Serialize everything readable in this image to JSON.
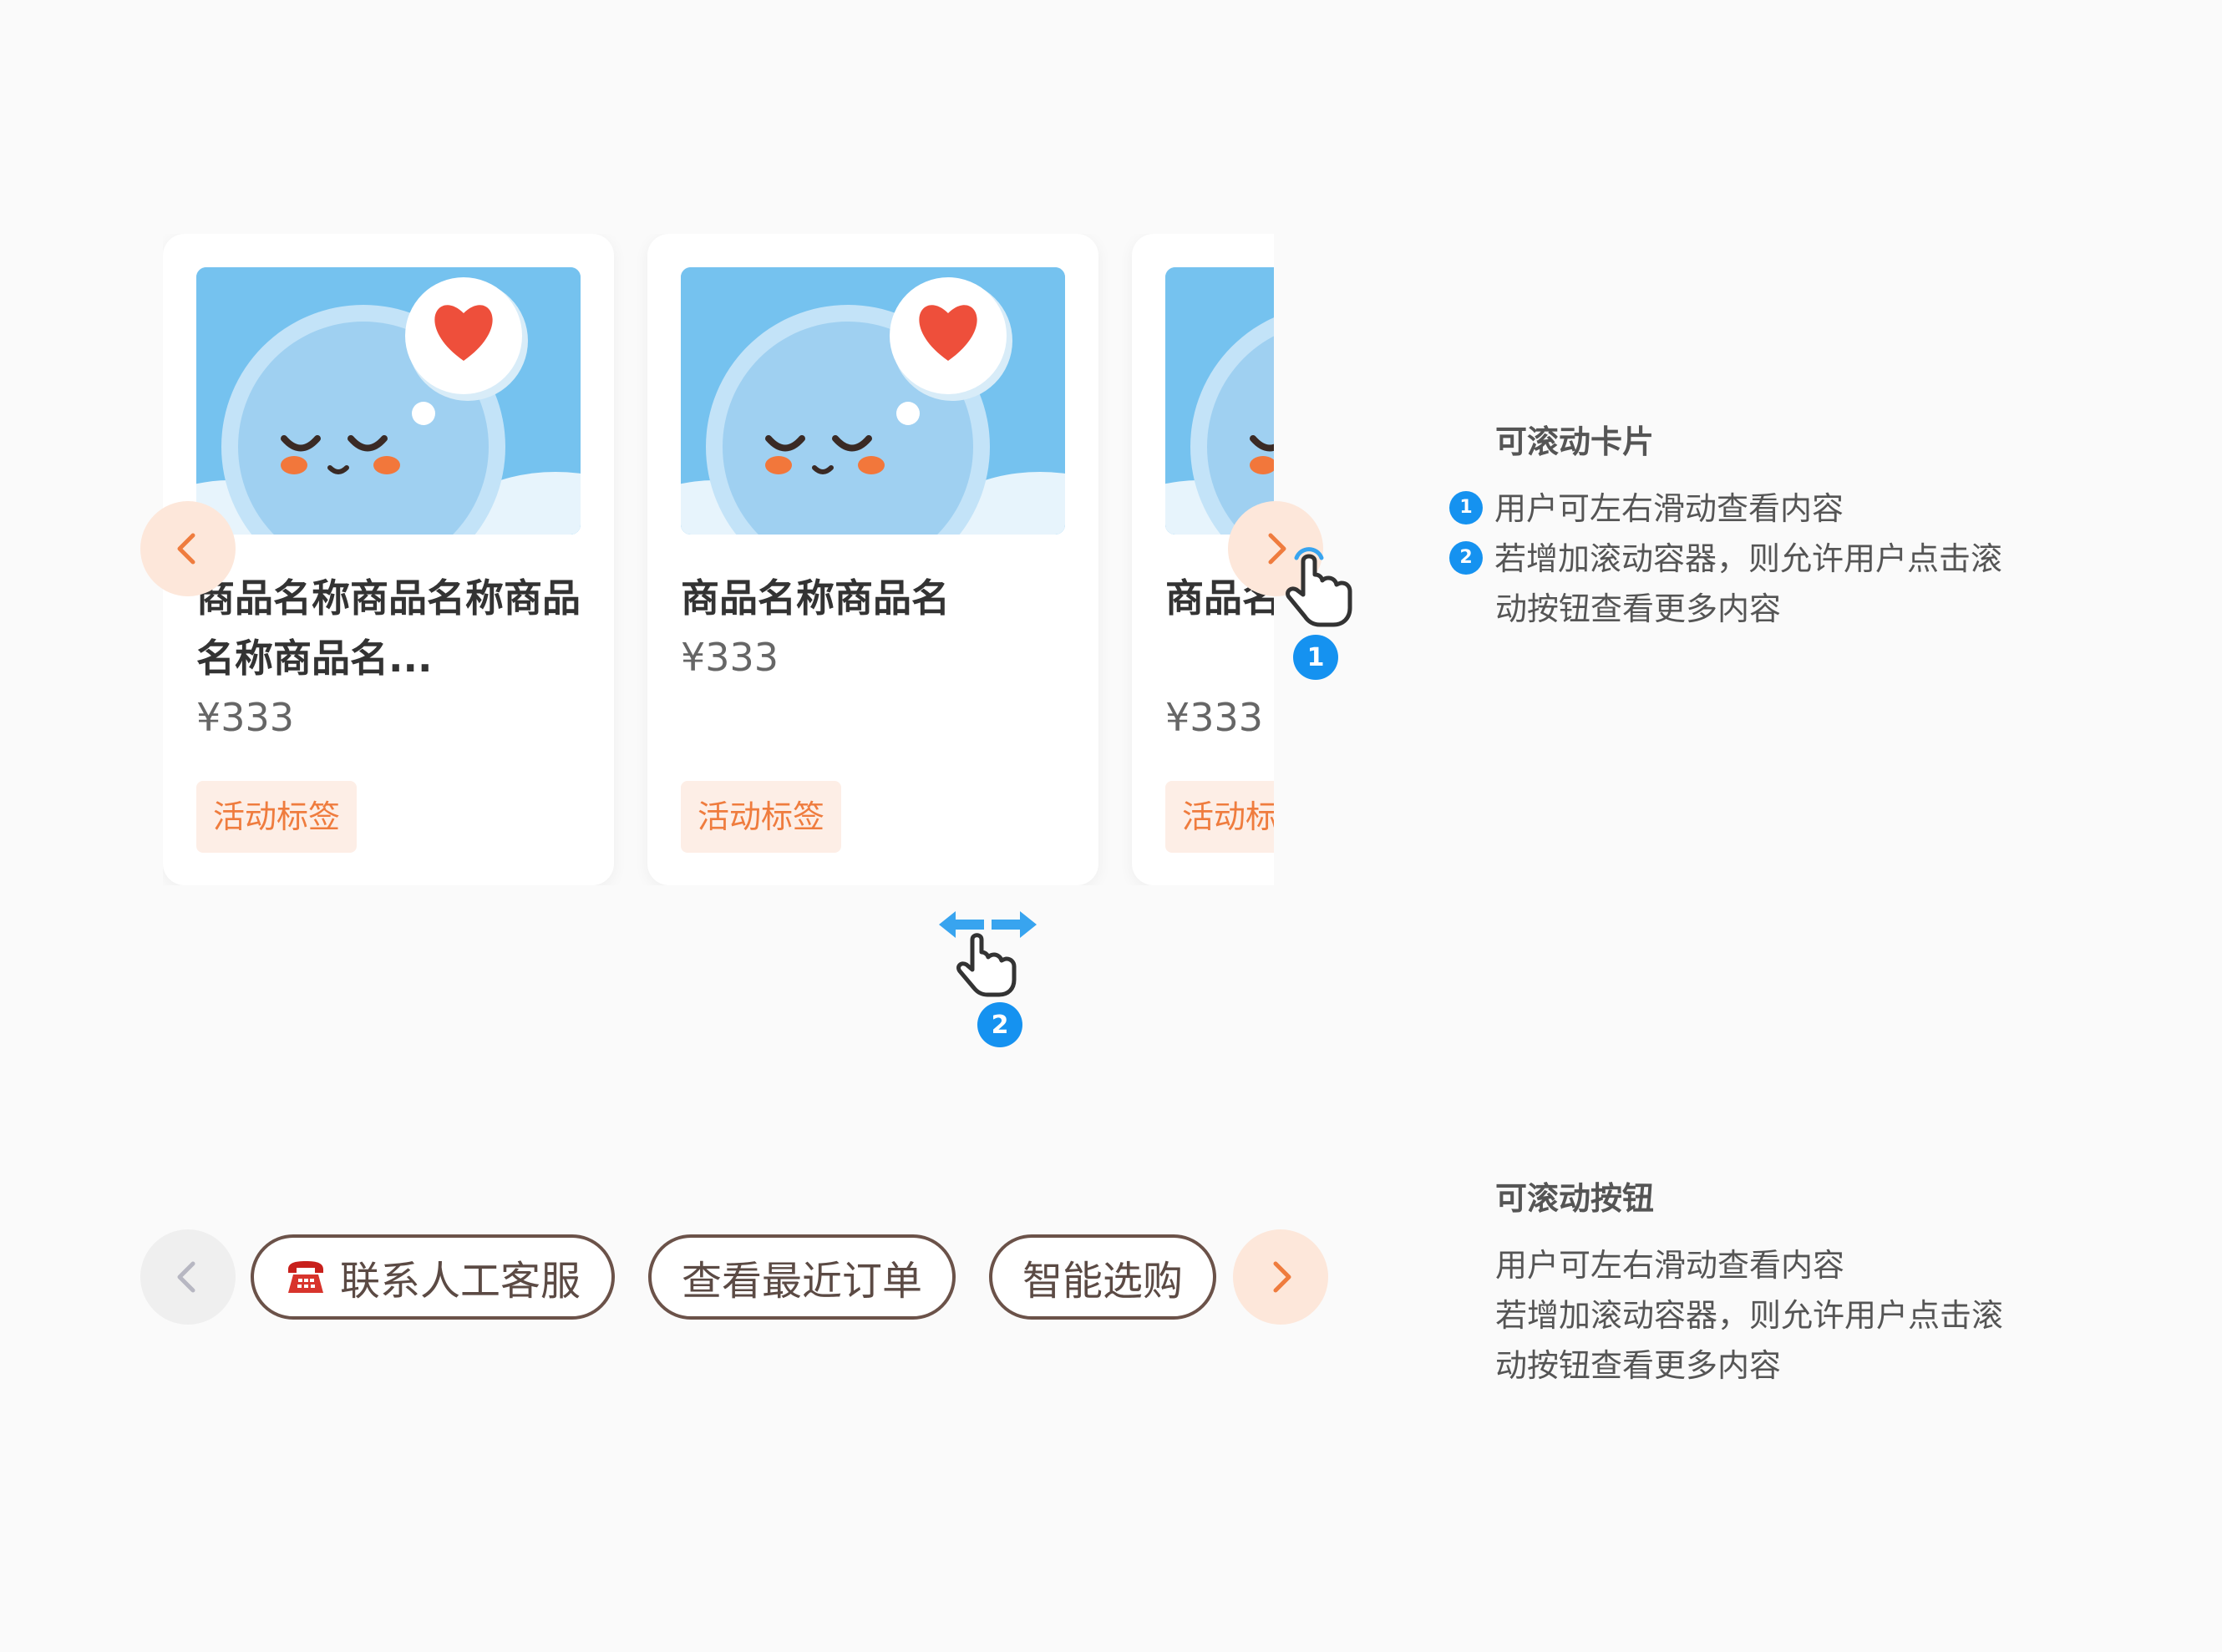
{
  "cards": [
    {
      "title": "商品名称商品名称商品名称商品名...",
      "price": "¥333",
      "tag": "活动标签"
    },
    {
      "title": "商品名称商品名",
      "price": "¥333",
      "tag": "活动标签"
    },
    {
      "title": "商品名称商品名称",
      "price": "¥333",
      "tag": "活动标签"
    }
  ],
  "card_callouts": {
    "badge1": "1",
    "badge2": "2"
  },
  "scroll_cards_info": {
    "title": "可滚动卡片",
    "item1_num": "1",
    "item1": "用户可左右滑动查看内容",
    "item2_num": "2",
    "item2_line1": "若增加滚动容器，则允许用户点击滚",
    "item2_line2": "动按钮查看更多内容"
  },
  "chips": [
    {
      "label": "联系人工客服",
      "icon": "phone-icon"
    },
    {
      "label": "查看最近订单"
    },
    {
      "label": "智能选购"
    }
  ],
  "scroll_buttons_info": {
    "title": "可滚动按钮",
    "line1": "用户可左右滑动查看内容",
    "line2": "若增加滚动容器，则允许用户点击滚",
    "line3": "动按钮查看更多内容"
  },
  "colors": {
    "accent_orange": "#ef7c3e",
    "tag_bg": "#fdeee6",
    "badge_blue": "#1592f0",
    "chip_border": "#6b5249"
  }
}
